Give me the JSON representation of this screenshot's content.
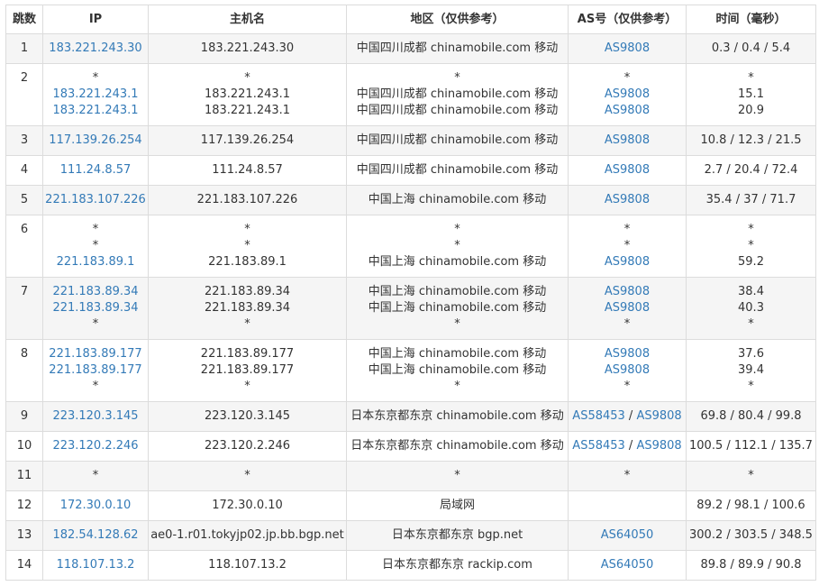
{
  "headers": {
    "hop": "跳数",
    "ip": "IP",
    "host": "主机名",
    "geo": "地区（仅供参考）",
    "as": "AS号（仅供参考）",
    "time": "时间（毫秒）"
  },
  "hops": [
    {
      "hop": "1",
      "lines": [
        {
          "ip": "183.221.243.30",
          "host": "183.221.243.30",
          "geo": "中国四川成都 chinamobile.com 移动",
          "as": [
            "AS9808"
          ],
          "time": "0.3 / 0.4 / 5.4"
        }
      ]
    },
    {
      "hop": "2",
      "lines": [
        {
          "ip": "*",
          "host": "*",
          "geo": "*",
          "as": [
            "*"
          ],
          "time": "*"
        },
        {
          "ip": "183.221.243.1",
          "host": "183.221.243.1",
          "geo": "中国四川成都 chinamobile.com 移动",
          "as": [
            "AS9808"
          ],
          "time": "15.1"
        },
        {
          "ip": "183.221.243.1",
          "host": "183.221.243.1",
          "geo": "中国四川成都 chinamobile.com 移动",
          "as": [
            "AS9808"
          ],
          "time": "20.9"
        }
      ]
    },
    {
      "hop": "3",
      "lines": [
        {
          "ip": "117.139.26.254",
          "host": "117.139.26.254",
          "geo": "中国四川成都 chinamobile.com 移动",
          "as": [
            "AS9808"
          ],
          "time": "10.8 / 12.3 / 21.5"
        }
      ]
    },
    {
      "hop": "4",
      "lines": [
        {
          "ip": "111.24.8.57",
          "host": "111.24.8.57",
          "geo": "中国四川成都 chinamobile.com 移动",
          "as": [
            "AS9808"
          ],
          "time": "2.7 / 20.4 / 72.4"
        }
      ]
    },
    {
      "hop": "5",
      "lines": [
        {
          "ip": "221.183.107.226",
          "host": "221.183.107.226",
          "geo": "中国上海 chinamobile.com 移动",
          "as": [
            "AS9808"
          ],
          "time": "35.4 / 37 / 71.7"
        }
      ]
    },
    {
      "hop": "6",
      "lines": [
        {
          "ip": "*",
          "host": "*",
          "geo": "*",
          "as": [
            "*"
          ],
          "time": "*"
        },
        {
          "ip": "*",
          "host": "*",
          "geo": "*",
          "as": [
            "*"
          ],
          "time": "*"
        },
        {
          "ip": "221.183.89.1",
          "host": "221.183.89.1",
          "geo": "中国上海 chinamobile.com 移动",
          "as": [
            "AS9808"
          ],
          "time": "59.2"
        }
      ]
    },
    {
      "hop": "7",
      "lines": [
        {
          "ip": "221.183.89.34",
          "host": "221.183.89.34",
          "geo": "中国上海 chinamobile.com 移动",
          "as": [
            "AS9808"
          ],
          "time": "38.4"
        },
        {
          "ip": "221.183.89.34",
          "host": "221.183.89.34",
          "geo": "中国上海 chinamobile.com 移动",
          "as": [
            "AS9808"
          ],
          "time": "40.3"
        },
        {
          "ip": "*",
          "host": "*",
          "geo": "*",
          "as": [
            "*"
          ],
          "time": "*"
        }
      ]
    },
    {
      "hop": "8",
      "lines": [
        {
          "ip": "221.183.89.177",
          "host": "221.183.89.177",
          "geo": "中国上海 chinamobile.com 移动",
          "as": [
            "AS9808"
          ],
          "time": "37.6"
        },
        {
          "ip": "221.183.89.177",
          "host": "221.183.89.177",
          "geo": "中国上海 chinamobile.com 移动",
          "as": [
            "AS9808"
          ],
          "time": "39.4"
        },
        {
          "ip": "*",
          "host": "*",
          "geo": "*",
          "as": [
            "*"
          ],
          "time": "*"
        }
      ]
    },
    {
      "hop": "9",
      "lines": [
        {
          "ip": "223.120.3.145",
          "host": "223.120.3.145",
          "geo": "日本东京都东京 chinamobile.com 移动",
          "as": [
            "AS58453",
            "AS9808"
          ],
          "time": "69.8 / 80.4 / 99.8"
        }
      ]
    },
    {
      "hop": "10",
      "lines": [
        {
          "ip": "223.120.2.246",
          "host": "223.120.2.246",
          "geo": "日本东京都东京 chinamobile.com 移动",
          "as": [
            "AS58453",
            "AS9808"
          ],
          "time": "100.5 / 112.1 / 135.7"
        }
      ]
    },
    {
      "hop": "11",
      "lines": [
        {
          "ip": "*",
          "host": "*",
          "geo": "*",
          "as": [
            "*"
          ],
          "time": "*"
        }
      ]
    },
    {
      "hop": "12",
      "lines": [
        {
          "ip": "172.30.0.10",
          "host": "172.30.0.10",
          "geo": "局域网",
          "as": [],
          "time": "89.2 / 98.1 / 100.6"
        }
      ]
    },
    {
      "hop": "13",
      "lines": [
        {
          "ip": "182.54.128.62",
          "host": "ae0-1.r01.tokyjp02.jp.bb.bgp.net",
          "geo": "日本东京都东京 bgp.net",
          "as": [
            "AS64050"
          ],
          "time": "300.2 / 303.5 / 348.5"
        }
      ]
    },
    {
      "hop": "14",
      "lines": [
        {
          "ip": "118.107.13.2",
          "host": "118.107.13.2",
          "geo": "日本东京都东京 rackip.com",
          "as": [
            "AS64050"
          ],
          "time": "89.8 / 89.9 / 90.8"
        }
      ]
    }
  ],
  "colors": {
    "link": "#337ab7",
    "text": "#333333",
    "stripe": "#f5f5f5",
    "border": "#dcdcdc"
  }
}
